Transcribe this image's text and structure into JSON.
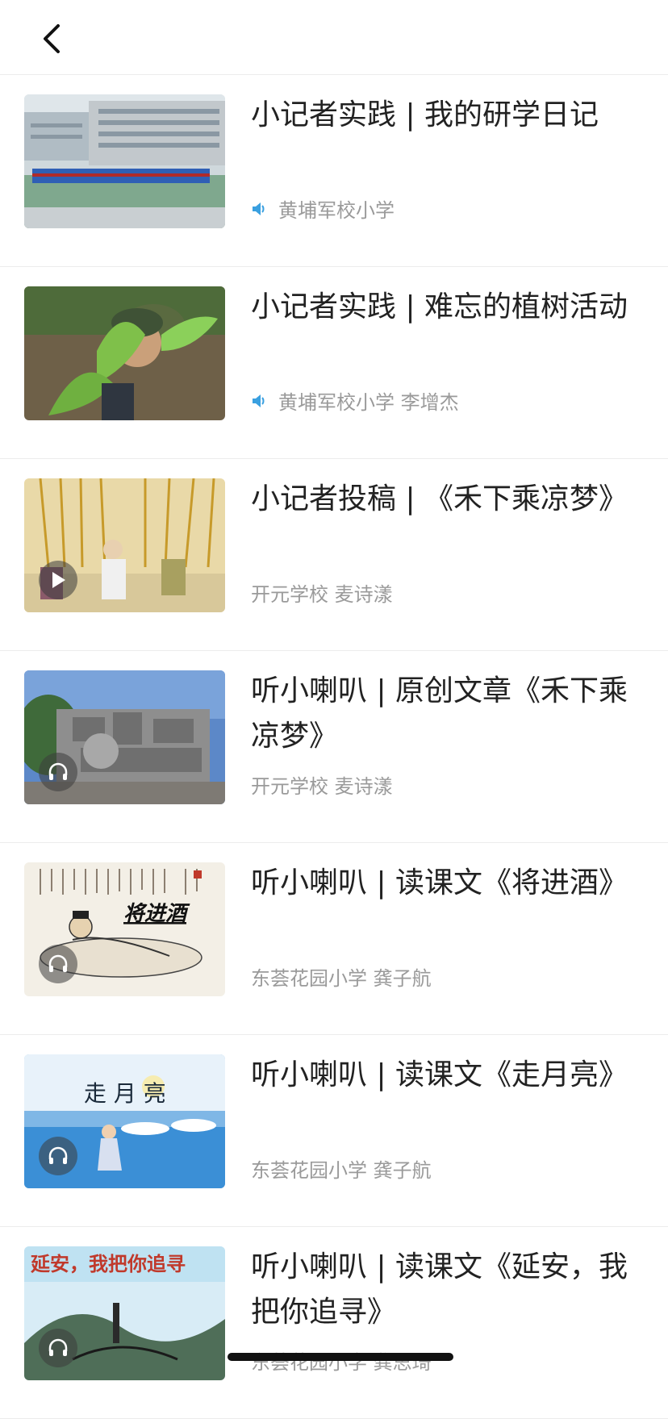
{
  "header": {
    "back_icon": "chevron-left-icon"
  },
  "items": [
    {
      "title": "小记者实践 | 我的研学日记",
      "meta": "黄埔军校小学",
      "audio_badge": true,
      "overlay": "none"
    },
    {
      "title": "小记者实践 | 难忘的植树活动",
      "meta": "黄埔军校小学 李增杰",
      "audio_badge": true,
      "overlay": "none"
    },
    {
      "title": "小记者投稿 | 《禾下乘凉梦》",
      "meta": "开元学校 麦诗漾",
      "audio_badge": false,
      "overlay": "play-icon"
    },
    {
      "title": "听小喇叭 | 原创文章《禾下乘凉梦》",
      "meta": "开元学校 麦诗漾",
      "audio_badge": false,
      "overlay": "headphones-icon"
    },
    {
      "title": "听小喇叭 | 读课文《将进酒》",
      "meta": "东荟花园小学 龚子航",
      "audio_badge": false,
      "overlay": "headphones-icon",
      "thumb_text": "将进酒"
    },
    {
      "title": "听小喇叭 | 读课文《走月亮》",
      "meta": "东荟花园小学 龚子航",
      "audio_badge": false,
      "overlay": "headphones-icon",
      "thumb_text": "走 月 亮"
    },
    {
      "title": "听小喇叭 | 读课文《延安，我把你追寻》",
      "meta": "东荟花园小学 龚思琦",
      "audio_badge": false,
      "overlay": "headphones-icon",
      "thumb_text": "延安，我把你追寻"
    }
  ],
  "colors": {
    "accent_audio": "#3aa0e0",
    "title": "#222222",
    "meta": "#9a9a9a",
    "divider": "#ececec"
  }
}
